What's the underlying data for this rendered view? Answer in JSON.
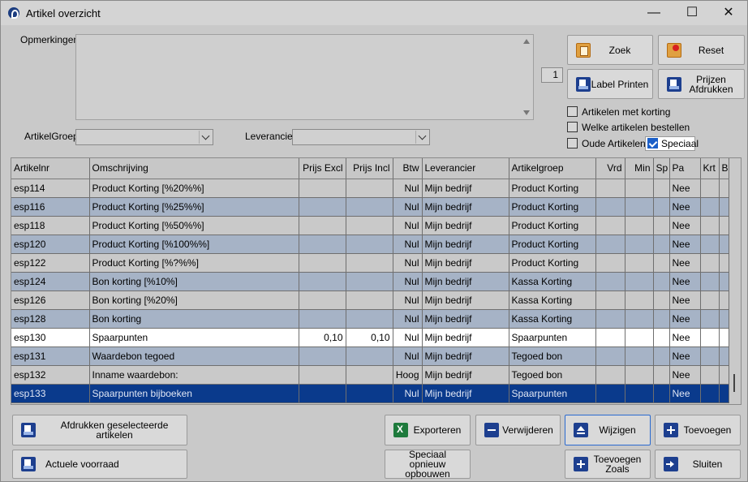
{
  "window": {
    "title": "Artikel overzicht",
    "controls": {
      "minimize": "—",
      "maximize": "☐",
      "close": "✕"
    }
  },
  "filters": {
    "remarks_label": "Opmerkingen",
    "remarks_value": "",
    "group_label": "ArtikelGroep",
    "group_value": "",
    "supplier_label": "Leverancier",
    "supplier_value": "",
    "page_number": "1"
  },
  "buttons": {
    "zoek": "Zoek",
    "reset": "Reset",
    "label_printen": "Label Printen",
    "prijzen_afdrukken": "Prijzen Afdrukken",
    "afdrukken_geselecteerd": "Afdrukken geselecteerde artikelen",
    "actuele_voorraad": "Actuele voorraad",
    "exporteren": "Exporteren",
    "speciaal_opnieuw": "Speciaal opnieuw opbouwen",
    "verwijderen": "Verwijderen",
    "wijzigen": "Wijzigen",
    "toevoegen": "Toevoegen",
    "toevoegen_zoals": "Toevoegen Zoals",
    "sluiten": "Sluiten"
  },
  "checkboxes": {
    "met_korting": {
      "label": "Artikelen met korting",
      "checked": false
    },
    "bestellen": {
      "label": "Welke artikelen bestellen",
      "checked": false
    },
    "oude": {
      "label": "Oude Artikelen",
      "checked": false
    },
    "speciaal": {
      "label": "Speciaal",
      "checked": true
    }
  },
  "table": {
    "columns": [
      "Artikelnr",
      "Omschrijving",
      "Prijs Excl",
      "Prijs Incl",
      "Btw",
      "Leverancier",
      "Artikelgroep",
      "Vrd",
      "Min",
      "Sp",
      "Pa",
      "Krt",
      "B"
    ],
    "rows": [
      [
        "esp114",
        "Product Korting [%20%%]",
        "",
        "",
        "Nul",
        "Mijn bedrijf",
        "Product Korting",
        "",
        "",
        "",
        "Nee",
        "",
        ""
      ],
      [
        "esp116",
        "Product Korting [%25%%]",
        "",
        "",
        "Nul",
        "Mijn bedrijf",
        "Product Korting",
        "",
        "",
        "",
        "Nee",
        "",
        ""
      ],
      [
        "esp118",
        "Product Korting [%50%%]",
        "",
        "",
        "Nul",
        "Mijn bedrijf",
        "Product Korting",
        "",
        "",
        "",
        "Nee",
        "",
        ""
      ],
      [
        "esp120",
        "Product Korting [%100%%]",
        "",
        "",
        "Nul",
        "Mijn bedrijf",
        "Product Korting",
        "",
        "",
        "",
        "Nee",
        "",
        ""
      ],
      [
        "esp122",
        "Product Korting [%?%%]",
        "",
        "",
        "Nul",
        "Mijn bedrijf",
        "Product Korting",
        "",
        "",
        "",
        "Nee",
        "",
        ""
      ],
      [
        "esp124",
        "Bon korting [%10%]",
        "",
        "",
        "Nul",
        "Mijn bedrijf",
        "Kassa Korting",
        "",
        "",
        "",
        "Nee",
        "",
        ""
      ],
      [
        "esp126",
        "Bon korting [%20%]",
        "",
        "",
        "Nul",
        "Mijn bedrijf",
        "Kassa Korting",
        "",
        "",
        "",
        "Nee",
        "",
        ""
      ],
      [
        "esp128",
        "Bon korting",
        "",
        "",
        "Nul",
        "Mijn bedrijf",
        "Kassa Korting",
        "",
        "",
        "",
        "Nee",
        "",
        ""
      ],
      [
        "esp130",
        "Spaarpunten",
        "0,10",
        "0,10",
        "Nul",
        "Mijn bedrijf",
        "Spaarpunten",
        "",
        "",
        "",
        "Nee",
        "",
        ""
      ],
      [
        "esp131",
        "Waardebon tegoed",
        "",
        "",
        "Nul",
        "Mijn bedrijf",
        "Tegoed bon",
        "",
        "",
        "",
        "Nee",
        "",
        ""
      ],
      [
        "esp132",
        "Inname waardebon:",
        "",
        "",
        "Hoog",
        "Mijn bedrijf",
        "Tegoed bon",
        "",
        "",
        "",
        "Nee",
        "",
        ""
      ],
      [
        "esp133",
        "Spaarpunten bijboeken",
        "",
        "",
        "Nul",
        "Mijn bedrijf",
        "Spaarpunten",
        "",
        "",
        "",
        "Nee",
        "",
        ""
      ]
    ],
    "row_styles": [
      "plain",
      "alt",
      "plain",
      "alt",
      "plain",
      "alt",
      "plain",
      "alt",
      "white",
      "alt",
      "plain",
      "sel"
    ]
  }
}
